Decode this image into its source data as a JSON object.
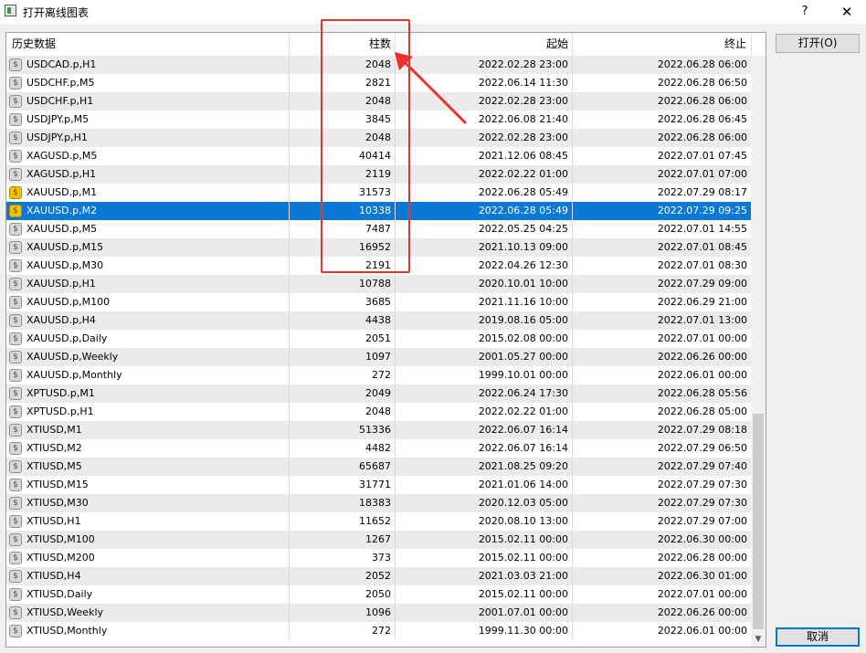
{
  "window": {
    "title": "打开离线图表",
    "help": "?",
    "close": "✕"
  },
  "table": {
    "headers": [
      "历史数据",
      "柱数",
      "起始",
      "终止"
    ],
    "selected_index": 8,
    "rows": [
      {
        "icon": "grey",
        "symbol": "USDCAD.p,H1",
        "bars": "2048",
        "start": "2022.02.28 23:00",
        "end": "2022.06.28 06:00"
      },
      {
        "icon": "grey",
        "symbol": "USDCHF.p,M5",
        "bars": "2821",
        "start": "2022.06.14 11:30",
        "end": "2022.06.28 06:50"
      },
      {
        "icon": "grey",
        "symbol": "USDCHF.p,H1",
        "bars": "2048",
        "start": "2022.02.28 23:00",
        "end": "2022.06.28 06:00"
      },
      {
        "icon": "grey",
        "symbol": "USDJPY.p,M5",
        "bars": "3845",
        "start": "2022.06.08 21:40",
        "end": "2022.06.28 06:45"
      },
      {
        "icon": "grey",
        "symbol": "USDJPY.p,H1",
        "bars": "2048",
        "start": "2022.02.28 23:00",
        "end": "2022.06.28 06:00"
      },
      {
        "icon": "grey",
        "symbol": "XAGUSD.p,M5",
        "bars": "40414",
        "start": "2021.12.06 08:45",
        "end": "2022.07.01 07:45"
      },
      {
        "icon": "grey",
        "symbol": "XAGUSD.p,H1",
        "bars": "2119",
        "start": "2022.02.22 01:00",
        "end": "2022.07.01 07:00"
      },
      {
        "icon": "gold",
        "symbol": "XAUUSD.p,M1",
        "bars": "31573",
        "start": "2022.06.28 05:49",
        "end": "2022.07.29 08:17"
      },
      {
        "icon": "gold",
        "symbol": "XAUUSD.p,M2",
        "bars": "10338",
        "start": "2022.06.28 05:49",
        "end": "2022.07.29 09:25"
      },
      {
        "icon": "grey",
        "symbol": "XAUUSD.p,M5",
        "bars": "7487",
        "start": "2022.05.25 04:25",
        "end": "2022.07.01 14:55"
      },
      {
        "icon": "grey",
        "symbol": "XAUUSD.p,M15",
        "bars": "16952",
        "start": "2021.10.13 09:00",
        "end": "2022.07.01 08:45"
      },
      {
        "icon": "grey",
        "symbol": "XAUUSD.p,M30",
        "bars": "2191",
        "start": "2022.04.26 12:30",
        "end": "2022.07.01 08:30"
      },
      {
        "icon": "grey",
        "symbol": "XAUUSD.p,H1",
        "bars": "10788",
        "start": "2020.10.01 10:00",
        "end": "2022.07.29 09:00"
      },
      {
        "icon": "grey",
        "symbol": "XAUUSD.p,M100",
        "bars": "3685",
        "start": "2021.11.16 10:00",
        "end": "2022.06.29 21:00"
      },
      {
        "icon": "grey",
        "symbol": "XAUUSD.p,H4",
        "bars": "4438",
        "start": "2019.08.16 05:00",
        "end": "2022.07.01 13:00"
      },
      {
        "icon": "grey",
        "symbol": "XAUUSD.p,Daily",
        "bars": "2051",
        "start": "2015.02.08 00:00",
        "end": "2022.07.01 00:00"
      },
      {
        "icon": "grey",
        "symbol": "XAUUSD.p,Weekly",
        "bars": "1097",
        "start": "2001.05.27 00:00",
        "end": "2022.06.26 00:00"
      },
      {
        "icon": "grey",
        "symbol": "XAUUSD.p,Monthly",
        "bars": "272",
        "start": "1999.10.01 00:00",
        "end": "2022.06.01 00:00"
      },
      {
        "icon": "grey",
        "symbol": "XPTUSD.p,M1",
        "bars": "2049",
        "start": "2022.06.24 17:30",
        "end": "2022.06.28 05:56"
      },
      {
        "icon": "grey",
        "symbol": "XPTUSD.p,H1",
        "bars": "2048",
        "start": "2022.02.22 01:00",
        "end": "2022.06.28 05:00"
      },
      {
        "icon": "grey",
        "symbol": "XTIUSD,M1",
        "bars": "51336",
        "start": "2022.06.07 16:14",
        "end": "2022.07.29 08:18"
      },
      {
        "icon": "grey",
        "symbol": "XTIUSD,M2",
        "bars": "4482",
        "start": "2022.06.07 16:14",
        "end": "2022.07.29 06:50"
      },
      {
        "icon": "grey",
        "symbol": "XTIUSD,M5",
        "bars": "65687",
        "start": "2021.08.25 09:20",
        "end": "2022.07.29 07:40"
      },
      {
        "icon": "grey",
        "symbol": "XTIUSD,M15",
        "bars": "31771",
        "start": "2021.01.06 14:00",
        "end": "2022.07.29 07:30"
      },
      {
        "icon": "grey",
        "symbol": "XTIUSD,M30",
        "bars": "18383",
        "start": "2020.12.03 05:00",
        "end": "2022.07.29 07:30"
      },
      {
        "icon": "grey",
        "symbol": "XTIUSD,H1",
        "bars": "11652",
        "start": "2020.08.10 13:00",
        "end": "2022.07.29 07:00"
      },
      {
        "icon": "grey",
        "symbol": "XTIUSD,M100",
        "bars": "1267",
        "start": "2015.02.11 00:00",
        "end": "2022.06.30 00:00"
      },
      {
        "icon": "grey",
        "symbol": "XTIUSD,M200",
        "bars": "373",
        "start": "2015.02.11 00:00",
        "end": "2022.06.28 00:00"
      },
      {
        "icon": "grey",
        "symbol": "XTIUSD,H4",
        "bars": "2052",
        "start": "2021.03.03 21:00",
        "end": "2022.06.30 01:00"
      },
      {
        "icon": "grey",
        "symbol": "XTIUSD,Daily",
        "bars": "2050",
        "start": "2015.02.11 00:00",
        "end": "2022.07.01 00:00"
      },
      {
        "icon": "grey",
        "symbol": "XTIUSD,Weekly",
        "bars": "1096",
        "start": "2001.07.01 00:00",
        "end": "2022.06.26 00:00"
      },
      {
        "icon": "grey",
        "symbol": "XTIUSD,Monthly",
        "bars": "272",
        "start": "1999.11.30 00:00",
        "end": "2022.06.01 00:00"
      }
    ]
  },
  "buttons": {
    "open": "打开(O)",
    "cancel": "取消"
  },
  "icons": {
    "symbol_icon_glyph": "$",
    "scroll_down_glyph": "▼"
  },
  "colors": {
    "selection": "#0a78d7",
    "annotation": "#e8322b",
    "gold_icon": "#f2c200"
  }
}
